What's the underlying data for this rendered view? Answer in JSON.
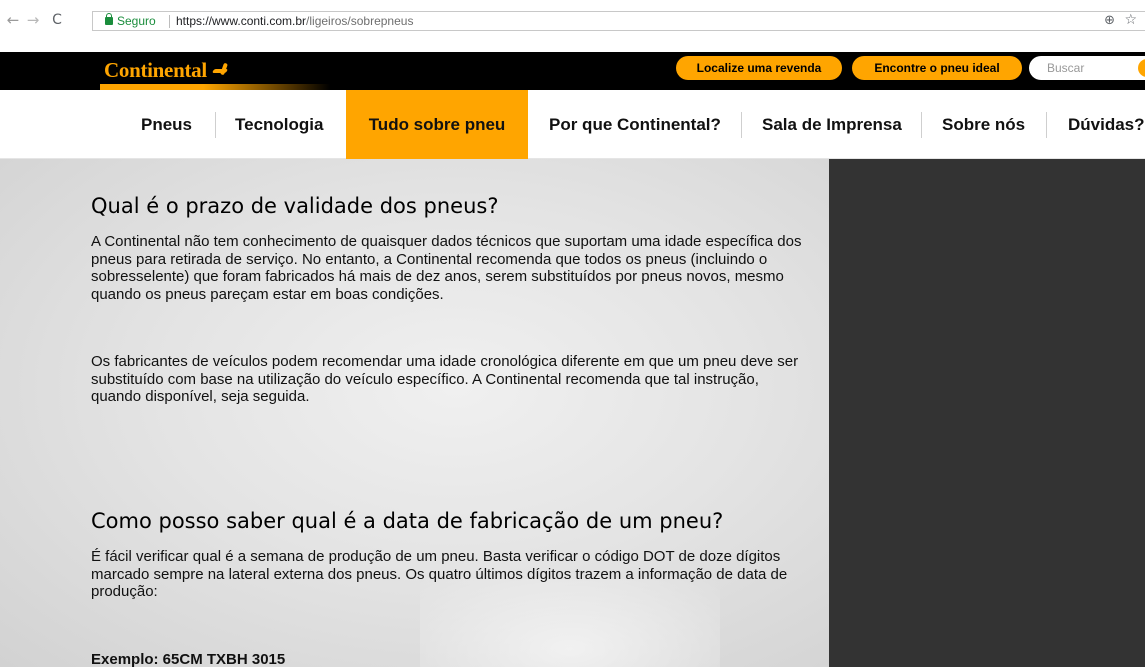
{
  "browser": {
    "secure_label": "Seguro",
    "url_host": "https://www.conti.com.br",
    "url_path": "/ligeiros/sobrepneus"
  },
  "header": {
    "logo_text": "Continental",
    "locate_dealer": "Localize uma revenda",
    "find_tire": "Encontre o pneu ideal",
    "search_placeholder": "Buscar",
    "accent_color": "#ffa500"
  },
  "nav": {
    "items": [
      {
        "label": "Pneus"
      },
      {
        "label": "Tecnologia"
      },
      {
        "label": "Tudo sobre pneu",
        "active": true
      },
      {
        "label": "Por que Continental?"
      },
      {
        "label": "Sala de Imprensa"
      },
      {
        "label": "Sobre nós"
      },
      {
        "label": "Dúvidas?"
      }
    ]
  },
  "main": {
    "sections": [
      {
        "title": "Qual é o prazo de validade dos pneus?",
        "paragraphs": [
          "A Continental não tem conhecimento de quaisquer dados técnicos que suportam uma idade específica dos pneus para retirada de serviço. No entanto, a Continental recomenda que todos os pneus (incluindo o sobresselente) que foram fabricados há mais de dez anos, serem substituídos por pneus novos, mesmo quando os pneus pareçam estar em boas condições.",
          "Os fabricantes de veículos podem recomendar uma idade cronológica diferente em que um pneu deve ser substituído com base na utilização do veículo específico. A Continental recomenda que tal instrução, quando disponível, seja seguida."
        ]
      },
      {
        "title": "Como posso saber qual é a data de fabricação de um pneu?",
        "paragraphs": [
          "É fácil verificar qual é a semana de produção de um pneu. Basta verificar o código DOT de doze dígitos marcado sempre na lateral externa dos pneus. Os quatro últimos dígitos trazem a informação de data de produção:"
        ],
        "example": "Exemplo: 65CM TXBH 3015"
      }
    ]
  }
}
